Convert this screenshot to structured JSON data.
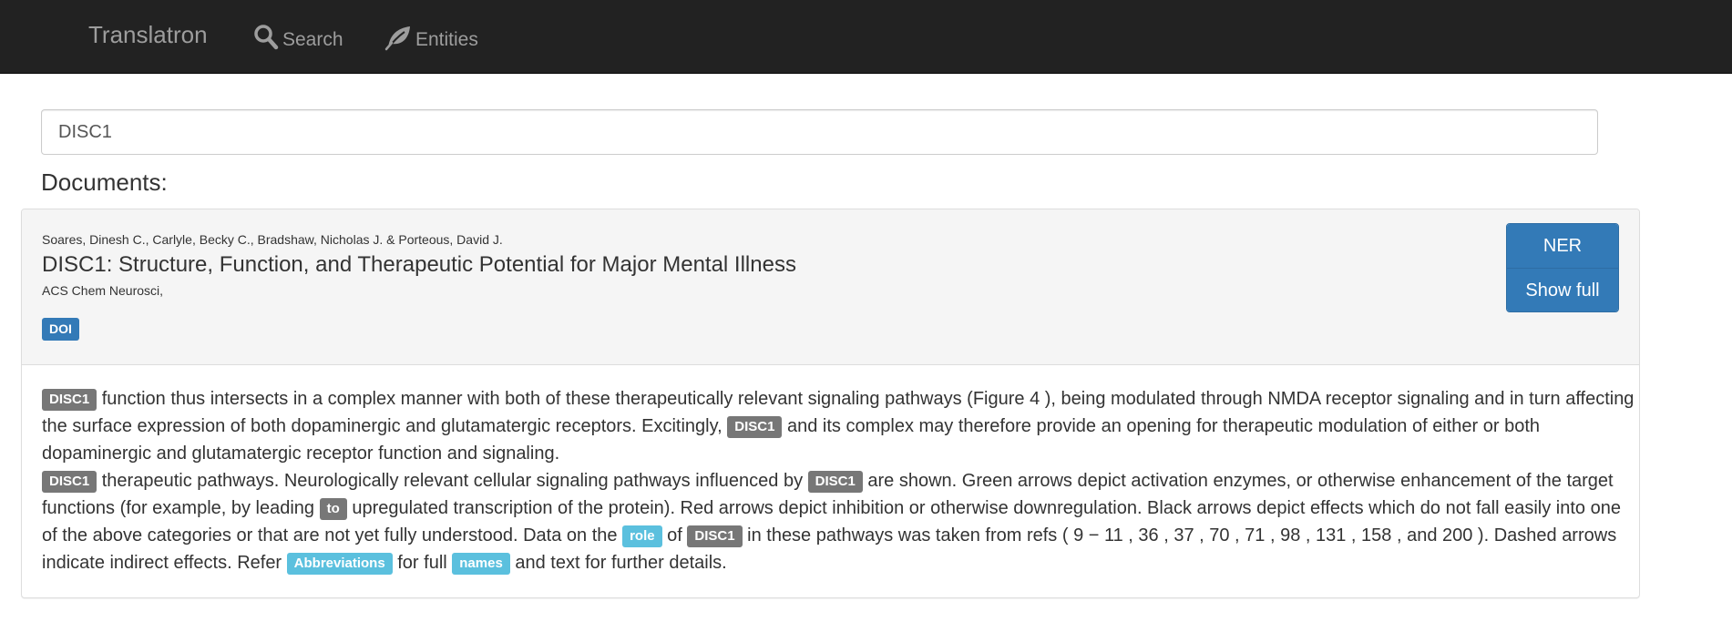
{
  "navbar": {
    "brand": "Translatron",
    "search_label": "Search",
    "entities_label": "Entities"
  },
  "search": {
    "value": "DISC1"
  },
  "documents_heading": "Documents:",
  "document": {
    "authors": "Soares, Dinesh C., Carlyle, Becky C., Bradshaw, Nicholas J. & Porteous, David J.",
    "title": "DISC1: Structure, Function, and Therapeutic Potential for Major Mental Illness",
    "journal": "ACS Chem Neurosci,",
    "doi_label": "DOI",
    "ner_button": "NER",
    "show_full_button": "Show full",
    "paragraph1": {
      "tag1": "DISC1",
      "text1": " function thus intersects in a complex manner with both of these therapeutically relevant signaling pathways (Figure 4 ), being modulated through NMDA receptor signaling and in turn affecting the surface expression of both dopaminergic and glutamatergic receptors. Excitingly, ",
      "tag2": "DISC1",
      "text2": " and its complex may therefore provide an opening for therapeutic modulation of either or both dopaminergic and glutamatergic receptor function and signaling."
    },
    "paragraph2": {
      "tag1": "DISC1",
      "text1": " therapeutic pathways. Neurologically relevant cellular signaling pathways influenced by ",
      "tag2": "DISC1",
      "text2": " are shown. Green arrows depict activation enzymes, or otherwise enhancement of the target functions (for example, by leading ",
      "tag3": "to",
      "text3": " upregulated transcription of the protein). Red arrows depict inhibition or otherwise downregulation. Black arrows depict effects which do not fall easily into one of the above categories or that are not yet fully understood. Data on the ",
      "tag4": "role",
      "text4": " of ",
      "tag5": "DISC1",
      "text5": " in these pathways was taken from refs ( 9 − 11 , 36 , 37 , 70 , 71 , 98 , 131 , 158 , and 200 ). Dashed arrows indicate indirect effects. Refer ",
      "tag6": "Abbreviations",
      "text6": " for full ",
      "tag7": "names",
      "text7": " and text for further details."
    }
  },
  "colors": {
    "navbar_bg": "#222222",
    "navbar_text": "#9d9d9d",
    "primary": "#337ab7",
    "tag_gray": "#777777",
    "tag_info": "#5bc0de",
    "panel_heading_bg": "#f5f5f5"
  },
  "icons": {
    "search": "search-icon",
    "entities": "leaf-icon"
  }
}
